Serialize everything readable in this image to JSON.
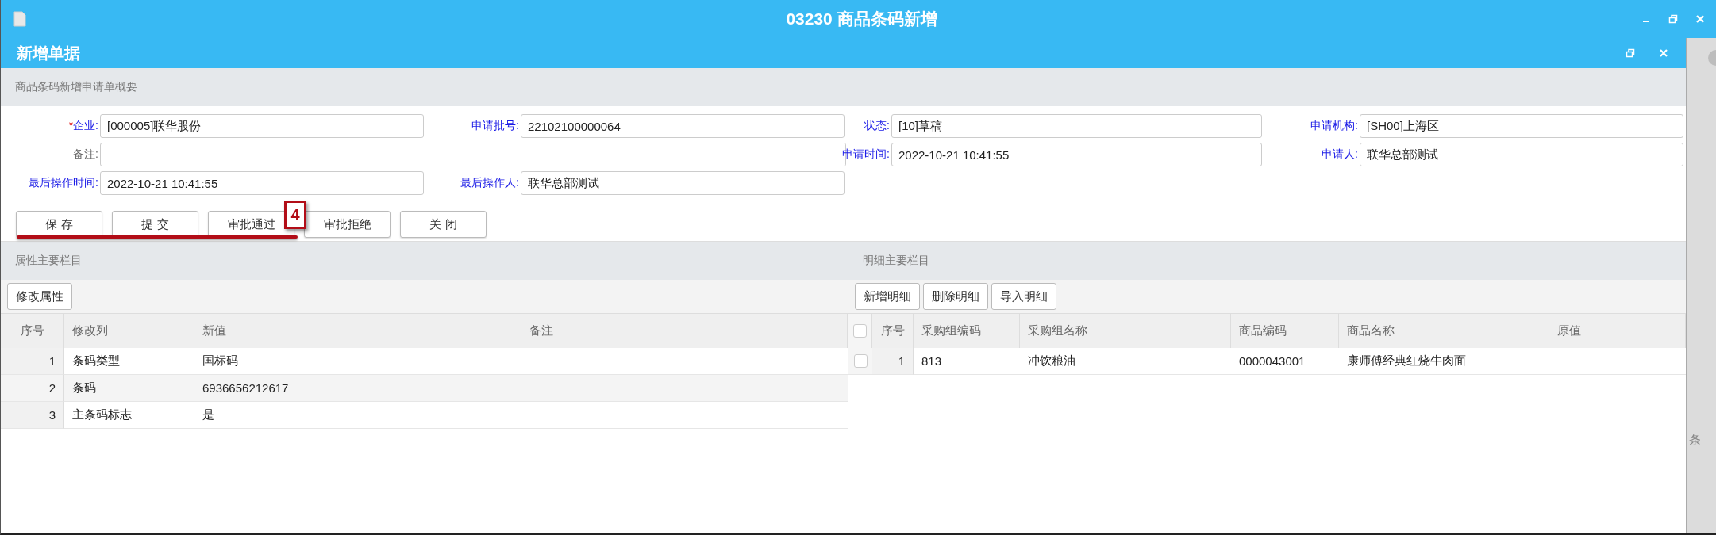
{
  "window": {
    "title": "03230 商品条码新增"
  },
  "dialog": {
    "title": "新增单据"
  },
  "summary": {
    "title": "商品条码新增申请单概要"
  },
  "form": {
    "fields": [
      {
        "kind": "text",
        "required_mark": "*",
        "label": "企业:",
        "value": "[000005]联华股份",
        "highlighted": true
      },
      {
        "kind": "text",
        "label": "申请批号:",
        "value": "22102100000064",
        "highlighted": true
      },
      {
        "kind": "text",
        "label": "状态:",
        "value": "[10]草稿",
        "highlighted": true
      },
      {
        "kind": "text",
        "label": "申请机构:",
        "value": "[SH00]上海区",
        "highlighted": true
      },
      {
        "kind": "memo",
        "label": "备注:",
        "highlighted": false
      },
      {
        "kind": "text",
        "label": "申请时间:",
        "value": "2022-10-21 10:41:55",
        "highlighted": true
      },
      {
        "kind": "text",
        "label": "申请人:",
        "value": "联华总部测试",
        "highlighted": true
      },
      {
        "kind": "text",
        "label": "最后操作时间:",
        "value": "2022-10-21 10:41:55",
        "highlighted": true
      },
      {
        "kind": "text",
        "label": "最后操作人:",
        "value": "联华总部测试",
        "highlighted": true
      }
    ]
  },
  "buttons": [
    "保 存",
    "提 交",
    "审批通过",
    "审批拒绝",
    "关 闭"
  ],
  "annotation": {
    "label": "4"
  },
  "attributes_panel": {
    "title": "属性主要栏目",
    "toolbar": [
      "修改属性"
    ],
    "table": {
      "columns": [
        "序号",
        "修改列",
        "新值",
        "备注"
      ],
      "rows": [
        [
          "1",
          "条码类型",
          "国标码",
          ""
        ],
        [
          "2",
          "条码",
          "6936656212617",
          ""
        ],
        [
          "3",
          "主条码标志",
          "是",
          ""
        ]
      ]
    }
  },
  "detail_panel": {
    "title": "明细主要栏目",
    "toolbar": [
      "新增明细",
      "删除明细",
      "导入明细"
    ],
    "table": {
      "header_checked": false,
      "columns": [
        "序号",
        "采购组编码",
        "采购组名称",
        "商品编码",
        "商品名称",
        "原值"
      ],
      "rows": [
        {
          "checked": false,
          "cells": [
            "1",
            "813",
            "冲饮粮油",
            "0000043001",
            "康师傅经典红烧牛肉面",
            ""
          ]
        }
      ]
    }
  },
  "side_strip": {
    "text": "条"
  }
}
